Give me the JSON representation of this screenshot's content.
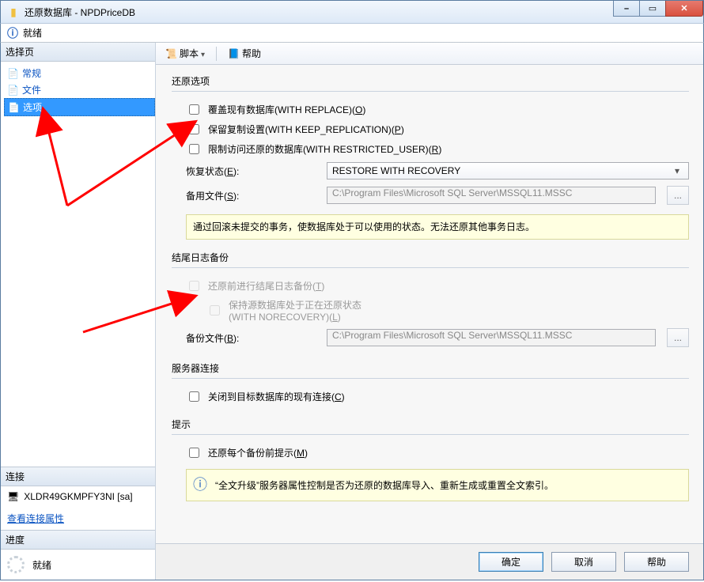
{
  "window": {
    "title": "还原数据库 - NPDPriceDB"
  },
  "status": {
    "text": "就绪"
  },
  "sidebar": {
    "header": "选择页",
    "items": [
      {
        "label": "常规"
      },
      {
        "label": "文件"
      },
      {
        "label": "选项"
      }
    ],
    "connection_header": "连接",
    "connection_text": "XLDR49GKMPFY3NI [sa]",
    "view_props_link": "查看连接属性",
    "progress_header": "进度",
    "progress_text": "就绪"
  },
  "toolbar": {
    "script": "脚本",
    "help": "帮助"
  },
  "groups": {
    "restore_options": "还原选项",
    "tail_log": "结尾日志备份",
    "server_conn": "服务器连接",
    "hint": "提示"
  },
  "checks": {
    "overwrite_pre": "覆盖现有数据库(WITH REPLACE)(",
    "overwrite_key": "O",
    "keep_repl_pre": "保留复制设置(WITH KEEP_REPLICATION)(",
    "keep_repl_key": "P",
    "restricted_pre": "限制访问还原的数据库(WITH RESTRICTED_USER)(",
    "restricted_key": "R",
    "tail_backup_pre": "还原前进行结尾日志备份(",
    "tail_backup_key": "T",
    "norecovery_line1": "保持源数据库处于正在还原状态",
    "norecovery_line2_pre": "(WITH NORECOVERY)(",
    "norecovery_key": "L",
    "close_conn_pre": "关闭到目标数据库的现有连接(",
    "close_conn_key": "C",
    "prompt_pre": "还原每个备份前提示(",
    "prompt_key": "M"
  },
  "labels": {
    "recovery_state_pre": "恢复状态(",
    "recovery_state_key": "E",
    "standby_file_pre": "备用文件(",
    "standby_file_key": "S",
    "backup_file_pre": "备份文件(",
    "backup_file_key": "B"
  },
  "values": {
    "recovery_state": "RESTORE WITH RECOVERY",
    "standby_file": "C:\\Program Files\\Microsoft SQL Server\\MSSQL11.MSSC",
    "backup_file": "C:\\Program Files\\Microsoft SQL Server\\MSSQL11.MSSC"
  },
  "info": {
    "recovery_desc": "通过回滚未提交的事务，使数据库处于可以使用的状态。无法还原其他事务日志。",
    "hint_text": "“全文升级”服务器属性控制是否为还原的数据库导入、重新生成或重置全文索引。"
  },
  "buttons": {
    "ok": "确定",
    "cancel": "取消",
    "help": "帮助",
    "browse": "..."
  }
}
